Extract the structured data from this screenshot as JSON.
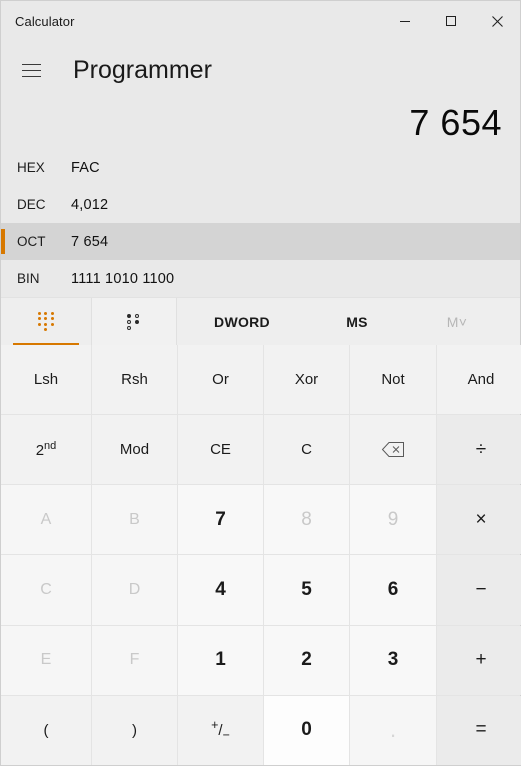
{
  "window": {
    "title": "Calculator",
    "controls": [
      {
        "name": "minimize",
        "glyph": "minimize-icon"
      },
      {
        "name": "maximize",
        "glyph": "maximize-icon"
      },
      {
        "name": "close",
        "glyph": "close-icon"
      }
    ]
  },
  "header": {
    "menu_icon": "hamburger-menu-icon",
    "mode": "Programmer"
  },
  "display": {
    "value": "7 654"
  },
  "radix": {
    "rows": [
      {
        "label": "HEX",
        "value": "FAC",
        "selected": false
      },
      {
        "label": "DEC",
        "value": "4,012",
        "selected": false
      },
      {
        "label": "OCT",
        "value": "7 654",
        "selected": true
      },
      {
        "label": "BIN",
        "value": "1111 1010 1100",
        "selected": false
      }
    ]
  },
  "toolbar": {
    "keypad_tab": "keypad-icon",
    "bits_tab": "bit-toggle-icon",
    "word_size": "DWORD",
    "memory_store": "MS",
    "memory_dropdown": "M˅"
  },
  "keypad": {
    "rows": [
      [
        {
          "label": "Lsh",
          "kind": "fn",
          "name": "left-shift"
        },
        {
          "label": "Rsh",
          "kind": "fn",
          "name": "right-shift"
        },
        {
          "label": "Or",
          "kind": "fn",
          "name": "or"
        },
        {
          "label": "Xor",
          "kind": "fn",
          "name": "xor"
        },
        {
          "label": "Not",
          "kind": "fn",
          "name": "not"
        },
        {
          "label": "And",
          "kind": "fn",
          "name": "and"
        }
      ],
      [
        {
          "label": "2nd",
          "kind": "fn-sup",
          "name": "second"
        },
        {
          "label": "Mod",
          "kind": "fn",
          "name": "modulo"
        },
        {
          "label": "CE",
          "kind": "fn",
          "name": "clear-entry"
        },
        {
          "label": "C",
          "kind": "fn",
          "name": "clear"
        },
        {
          "label": "",
          "kind": "backspace",
          "name": "backspace"
        },
        {
          "label": "÷",
          "kind": "op",
          "name": "divide"
        }
      ],
      [
        {
          "label": "A",
          "kind": "hexdim",
          "name": "hex-a"
        },
        {
          "label": "B",
          "kind": "hexdim",
          "name": "hex-b"
        },
        {
          "label": "7",
          "kind": "digit",
          "name": "digit-7"
        },
        {
          "label": "8",
          "kind": "digit-disabled",
          "name": "digit-8"
        },
        {
          "label": "9",
          "kind": "digit-disabled",
          "name": "digit-9"
        },
        {
          "label": "×",
          "kind": "op",
          "name": "multiply"
        }
      ],
      [
        {
          "label": "C",
          "kind": "hexdim",
          "name": "hex-c"
        },
        {
          "label": "D",
          "kind": "hexdim",
          "name": "hex-d"
        },
        {
          "label": "4",
          "kind": "digit",
          "name": "digit-4"
        },
        {
          "label": "5",
          "kind": "digit",
          "name": "digit-5"
        },
        {
          "label": "6",
          "kind": "digit",
          "name": "digit-6"
        },
        {
          "label": "−",
          "kind": "op",
          "name": "subtract"
        }
      ],
      [
        {
          "label": "E",
          "kind": "hexdim",
          "name": "hex-e"
        },
        {
          "label": "F",
          "kind": "hexdim",
          "name": "hex-f"
        },
        {
          "label": "1",
          "kind": "digit",
          "name": "digit-1"
        },
        {
          "label": "2",
          "kind": "digit",
          "name": "digit-2"
        },
        {
          "label": "3",
          "kind": "digit",
          "name": "digit-3"
        },
        {
          "label": "+",
          "kind": "op",
          "name": "add"
        }
      ],
      [
        {
          "label": "(",
          "kind": "fn",
          "name": "open-paren"
        },
        {
          "label": ")",
          "kind": "fn",
          "name": "close-paren"
        },
        {
          "label": "+/-",
          "kind": "plusminus",
          "name": "negate"
        },
        {
          "label": "0",
          "kind": "digit-hover",
          "name": "digit-0"
        },
        {
          "label": ".",
          "kind": "dot-disabled",
          "name": "decimal-point"
        },
        {
          "label": "=",
          "kind": "eq",
          "name": "equals"
        }
      ]
    ]
  },
  "colors": {
    "accent": "#d77800",
    "window_bg": "#e9e9e9",
    "key_bg": "#f6f6f6",
    "op_bg": "#ebebeb",
    "selected_row_bg": "#d4d4d4",
    "disabled_text": "#c9c9c9"
  }
}
